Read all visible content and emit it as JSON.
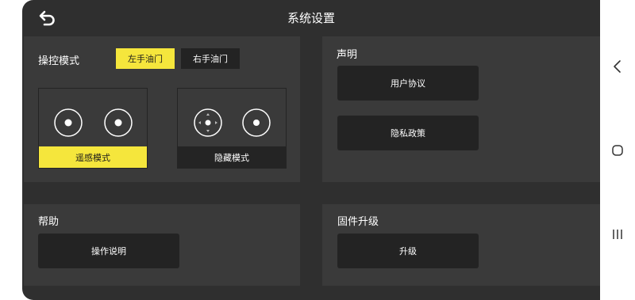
{
  "header": {
    "title": "系统设置"
  },
  "control_mode": {
    "title": "操控模式",
    "throttle_options": [
      "左手油门",
      "右手油门"
    ],
    "selected_throttle": "左手油门",
    "modes": [
      {
        "label": "遥感模式",
        "selected": true
      },
      {
        "label": "隐藏模式",
        "selected": false
      }
    ]
  },
  "statement": {
    "title": "声明",
    "buttons": [
      "用户协议",
      "隐私政策"
    ]
  },
  "help": {
    "title": "帮助",
    "button": "操作说明"
  },
  "firmware": {
    "title": "固件升级",
    "button": "升级"
  },
  "colors": {
    "accent": "#f5e63c",
    "background": "#2f2f2f",
    "card": "#3a3a3a",
    "button": "#232323"
  },
  "icons": {
    "back": "back-arrow-icon",
    "nav_back": "chevron-left-icon",
    "nav_home": "circle-home-icon",
    "nav_recents": "recents-lines-icon"
  }
}
